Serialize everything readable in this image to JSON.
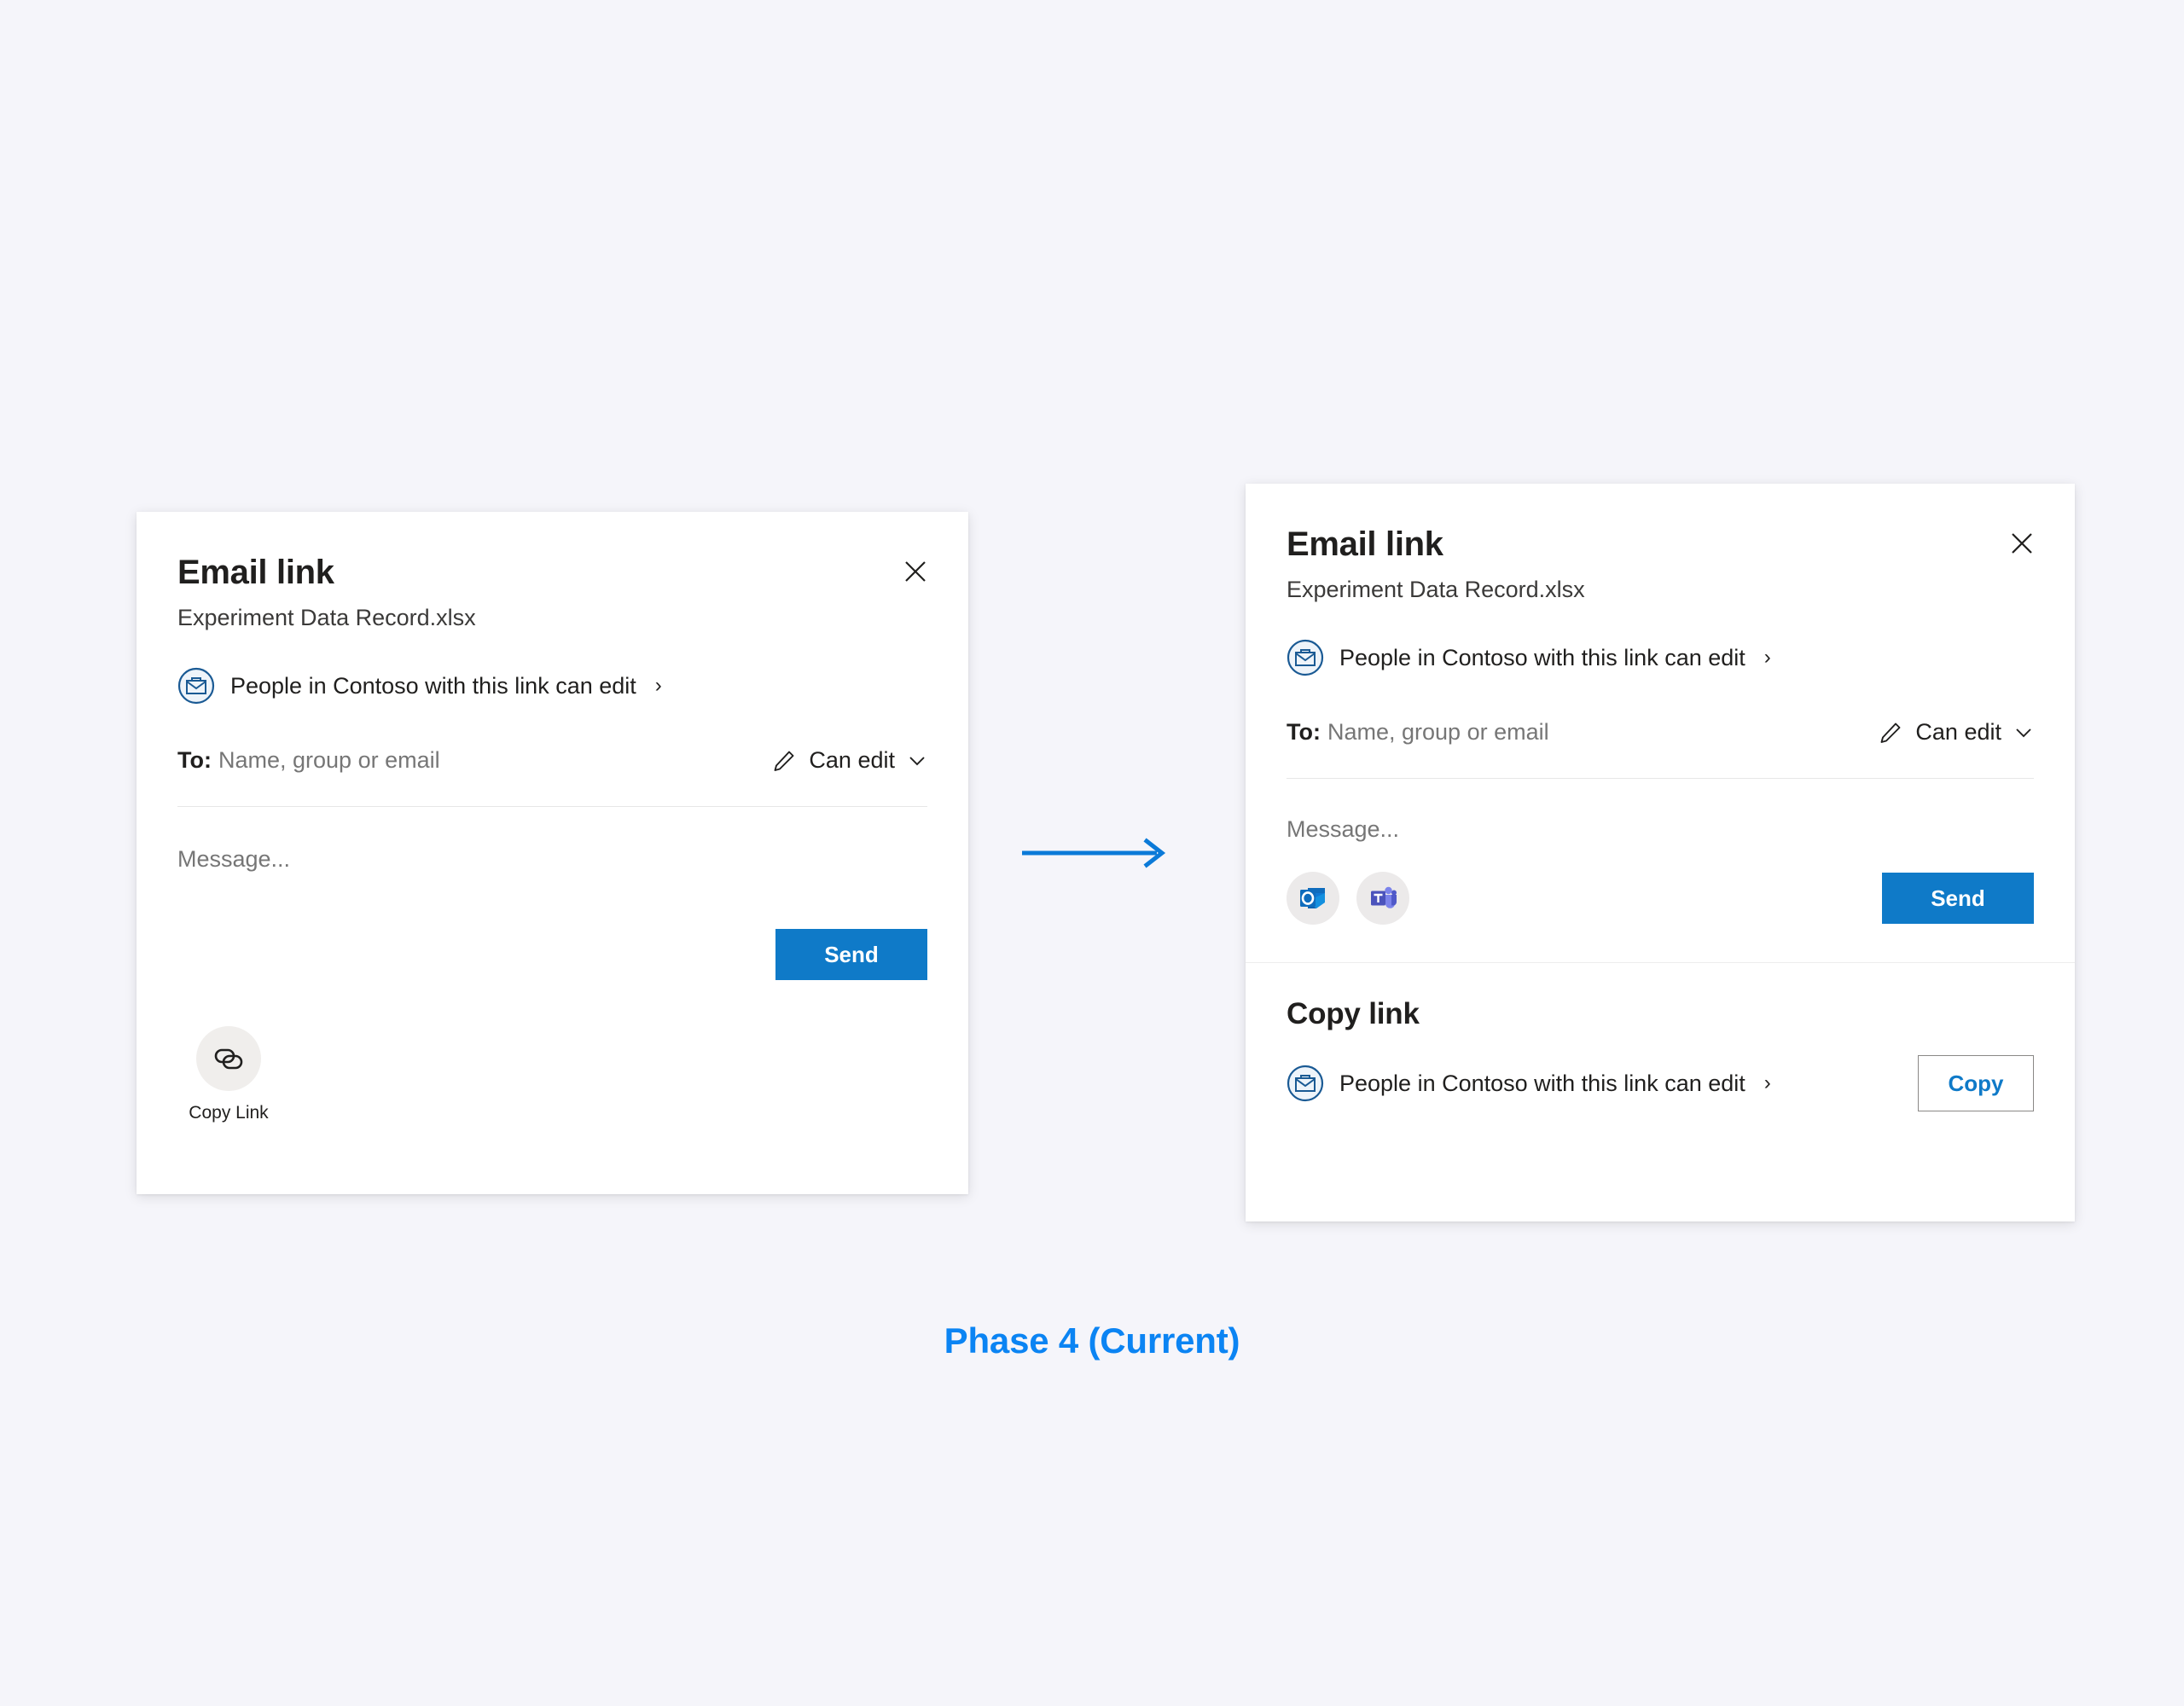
{
  "caption": "Phase 4 (Current)",
  "colors": {
    "background": "#f5f5fa",
    "card": "#ffffff",
    "accent_blue": "#0f7ac8",
    "caption_blue": "#0b84f3",
    "arrow_blue": "#0b7ad8",
    "briefcase_blue": "#1a5a94",
    "text_primary": "#201f1e",
    "text_secondary": "#767676",
    "divider": "#e6e6e6",
    "chip_background": "#eceaea"
  },
  "left_card": {
    "title": "Email link",
    "file_name": "Experiment Data Record.xlsx",
    "close_label": "Close",
    "audience": {
      "icon": "briefcase-icon",
      "label": "People in Contoso with this link can edit",
      "chevron": "›"
    },
    "to_field": {
      "label": "To:",
      "placeholder": "Name, group or email"
    },
    "permission": {
      "icon": "pencil-icon",
      "value": "Can edit"
    },
    "message": {
      "placeholder": "Message..."
    },
    "send_label": "Send",
    "copy_link_tile": {
      "icon": "chain-link-icon",
      "label": "Copy Link"
    }
  },
  "right_card": {
    "title": "Email link",
    "file_name": "Experiment Data Record.xlsx",
    "close_label": "Close",
    "audience": {
      "icon": "briefcase-icon",
      "label": "People in Contoso with this link can edit",
      "chevron": "›"
    },
    "to_field": {
      "label": "To:",
      "placeholder": "Name, group or email"
    },
    "permission": {
      "icon": "pencil-icon",
      "value": "Can edit"
    },
    "message": {
      "placeholder": "Message..."
    },
    "send_label": "Send",
    "app_shortcuts": [
      {
        "icon": "outlook-icon",
        "name": "Outlook"
      },
      {
        "icon": "teams-icon",
        "name": "Microsoft Teams"
      }
    ],
    "copy_link_section": {
      "heading": "Copy link",
      "audience": {
        "icon": "briefcase-icon",
        "label": "People in Contoso with this link can edit",
        "chevron": "›"
      },
      "copy_label": "Copy"
    }
  }
}
